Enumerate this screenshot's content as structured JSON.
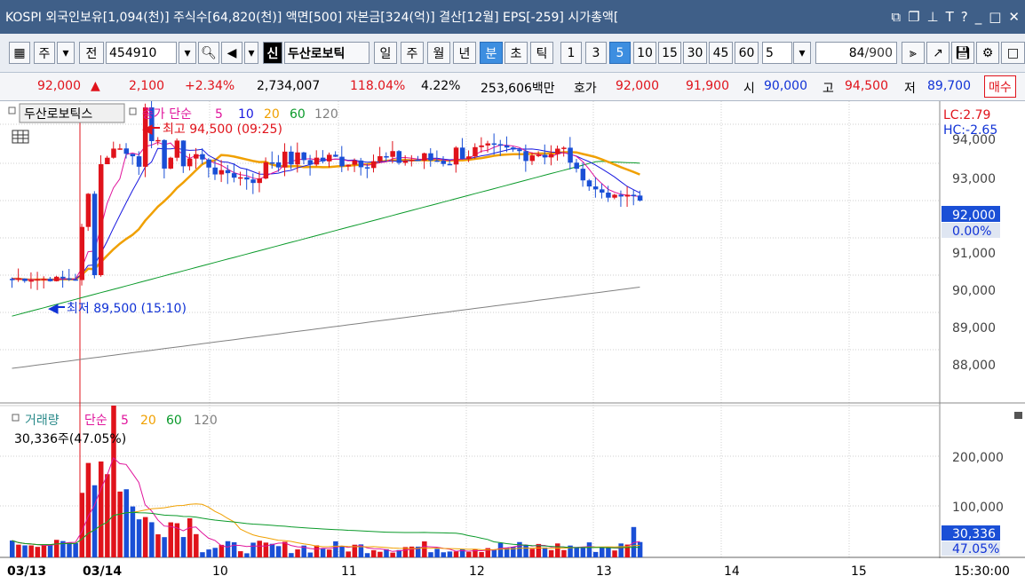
{
  "titlebar": {
    "text": "KOSPI 외국인보유[1,094(천)] 주식수[64,820(천)] 액면[500] 자본금[324(억)] 결산[12월] EPS[-259] 시가총액[",
    "icons": [
      "restore-icon",
      "copy-icon",
      "pin-icon",
      "font-icon",
      "help-icon",
      "minimize-icon",
      "maximize-icon",
      "close-icon"
    ]
  },
  "toolbar": {
    "mode": "주",
    "prefix": "전",
    "code": "454910",
    "brand": "신",
    "name": "두산로보틱",
    "periods": [
      "일",
      "주",
      "월",
      "년",
      "분",
      "초",
      "틱"
    ],
    "selected_period": "분",
    "intervals": [
      "1",
      "3",
      "5",
      "10",
      "15",
      "30",
      "45",
      "60"
    ],
    "selected_interval": "5",
    "interval_value": "5",
    "count": "84",
    "count_max": "/900"
  },
  "info": {
    "price": "92,000",
    "change_sign": "▲",
    "change": "2,100",
    "change_pct": "+2.34%",
    "volume": "2,734,007",
    "vol_ratio": "118.04%",
    "turnover": "4.22%",
    "amount": "253,606백만",
    "ask_label": "호가",
    "ask1": "92,000",
    "ask2": "91,900",
    "open_label": "시",
    "open": "90,000",
    "high_label": "고",
    "high": "94,500",
    "low_label": "저",
    "low": "89,700",
    "buy_label": "매수"
  },
  "chart_data": [
    {
      "type": "candlestick",
      "stock_name": "두산로보틱스",
      "legend": {
        "label": "종가 단순",
        "periods": [
          "5",
          "10",
          "20",
          "60",
          "120"
        ],
        "colors": [
          "#e0159c",
          "#1a1ae0",
          "#f0a000",
          "#0a9a2a",
          "#808080"
        ]
      },
      "high_label": "최고 94,500 (09:25)",
      "low_label": "최저 89,500 (15:10)",
      "lc_label": "LC:2.79",
      "hc_label": "HC:-2.65",
      "y_ticks": [
        "94,000",
        "93,000",
        "92,000",
        "91,000",
        "90,000",
        "89,000",
        "88,000"
      ],
      "current_price": "92,000",
      "current_pct": "0.00%",
      "x_labels": [
        "03/13",
        "03/14",
        "10",
        "11",
        "12",
        "13",
        "14",
        "15"
      ],
      "time_label": "15:30:00"
    },
    {
      "type": "bar",
      "name": "거래량",
      "legend": {
        "label": "단순",
        "periods": [
          "5",
          "20",
          "60",
          "120"
        ]
      },
      "current_text": "30,336주(47.05%)",
      "y_ticks": [
        "200,000",
        "100,000"
      ],
      "current_value": "30,336",
      "current_pct": "47.05%"
    }
  ]
}
